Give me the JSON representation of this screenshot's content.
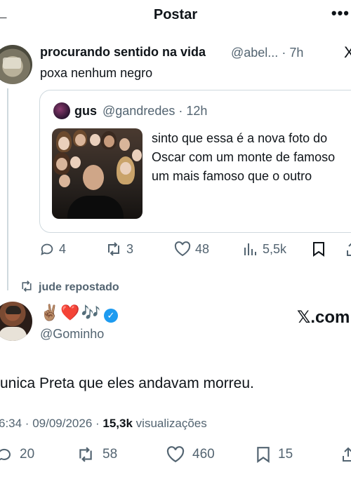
{
  "header": {
    "back_icon": "arrow-left-icon",
    "title": "Postar",
    "more_icon": "more-icon"
  },
  "parent_tweet": {
    "name": "procurando sentido na vida",
    "handle": "@abel...",
    "time": "7h",
    "text": "poxa nenhum negro",
    "quote": {
      "name": "gus",
      "handle": "@gandredes",
      "time": "12h",
      "text": "sinto que essa é a nova foto do Oscar com um monte de famoso um mais famoso que o outro"
    },
    "actions": {
      "replies": "4",
      "reposts": "3",
      "likes": "48",
      "views": "5,5k"
    }
  },
  "repost_label": "jude repostado",
  "main_tweet": {
    "emoji_name": "✌🏽❤️🎶",
    "handle": "@Gominho",
    "brand": "𝕏.com",
    "text": "unica Preta que eles andavam morreu.",
    "time_date": "6:34 · 09/09/2026 · ",
    "views_count": "15,3k",
    "views_label": " visualizações",
    "actions": {
      "replies": "20",
      "reposts": "58",
      "likes": "460",
      "bookmarks": "15"
    }
  },
  "colors": {
    "text": "#0f1419",
    "muted": "#536471",
    "border": "#cfd9de",
    "verified": "#1d9bf0",
    "heart": "#e0245e"
  }
}
